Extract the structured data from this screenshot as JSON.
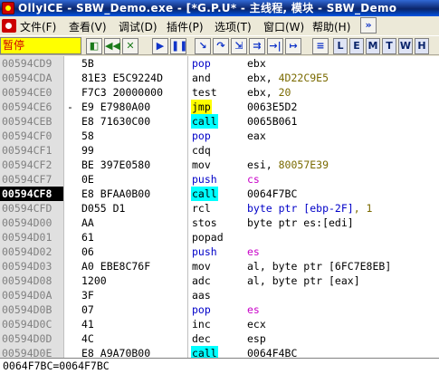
{
  "window": {
    "title": "OllyICE - SBW_Demo.exe - [*G.P.U* -  主线程, 模块 - SBW_Demo"
  },
  "menu": [
    {
      "label": "文件(F)"
    },
    {
      "label": "查看(V)"
    },
    {
      "label": "调试(D)"
    },
    {
      "label": "插件(P)"
    },
    {
      "label": "选项(T)"
    },
    {
      "label": "窗口(W)"
    },
    {
      "label": "帮助(H)"
    }
  ],
  "toolbar": {
    "status": "暂停",
    "letters": [
      "L",
      "E",
      "M",
      "T",
      "W",
      "H"
    ]
  },
  "colors": {
    "selection_bg": "#000000",
    "jump_highlight": "#ffff00",
    "call_highlight": "#00ffff",
    "constant_color": "#7a6a00",
    "keyword_color": "#0000c8",
    "segment_color": "#c800c8",
    "status_bg": "#ffff00",
    "status_fg": "#d00000"
  },
  "disasm": [
    {
      "addr": "00594CD9",
      "mark": "",
      "hex": "5B",
      "mnemonic": "pop",
      "mn_style": "blue",
      "op1": "ebx",
      "op1_style": "",
      "op2": "",
      "op2_style": "",
      "sel": false
    },
    {
      "addr": "00594CDA",
      "mark": "",
      "hex": "81E3 E5C9224D",
      "mnemonic": "and",
      "mn_style": "",
      "op1": "ebx, ",
      "op1_style": "",
      "op2": "4D22C9E5",
      "op2_style": "o",
      "sel": false
    },
    {
      "addr": "00594CE0",
      "mark": "",
      "hex": "F7C3 20000000",
      "mnemonic": "test",
      "mn_style": "",
      "op1": "ebx, ",
      "op1_style": "",
      "op2": "20",
      "op2_style": "o",
      "sel": false
    },
    {
      "addr": "00594CE6",
      "mark": "-",
      "hex": "E9 E7980A00",
      "mnemonic": "jmp",
      "mn_style": "yellow",
      "op1": "0063E5D2",
      "op1_style": "",
      "op2": "",
      "op2_style": "",
      "sel": false
    },
    {
      "addr": "00594CEB",
      "mark": "",
      "hex": "E8 71630C00",
      "mnemonic": "call",
      "mn_style": "cyan",
      "op1": "0065B061",
      "op1_style": "",
      "op2": "",
      "op2_style": "",
      "sel": false
    },
    {
      "addr": "00594CF0",
      "mark": "",
      "hex": "58",
      "mnemonic": "pop",
      "mn_style": "blue",
      "op1": "eax",
      "op1_style": "",
      "op2": "",
      "op2_style": "",
      "sel": false
    },
    {
      "addr": "00594CF1",
      "mark": "",
      "hex": "99",
      "mnemonic": "cdq",
      "mn_style": "",
      "op1": "",
      "op1_style": "",
      "op2": "",
      "op2_style": "",
      "sel": false
    },
    {
      "addr": "00594CF2",
      "mark": "",
      "hex": "BE 397E0580",
      "mnemonic": "mov",
      "mn_style": "",
      "op1": "esi, ",
      "op1_style": "",
      "op2": "80057E39",
      "op2_style": "o",
      "sel": false
    },
    {
      "addr": "00594CF7",
      "mark": "",
      "hex": "0E",
      "mnemonic": "push",
      "mn_style": "blue",
      "op1": "cs",
      "op1_style": "m",
      "op2": "",
      "op2_style": "",
      "sel": false
    },
    {
      "addr": "00594CF8",
      "mark": "",
      "hex": "E8 BFAA0B00",
      "mnemonic": "call",
      "mn_style": "cyan",
      "op1": "0064F7BC",
      "op1_style": "",
      "op2": "",
      "op2_style": "",
      "sel": true
    },
    {
      "addr": "00594CFD",
      "mark": "",
      "hex": "D055 D1",
      "mnemonic": "rcl",
      "mn_style": "",
      "op1": "byte ptr [ebp-2F]",
      "op1_style": "b",
      "op2": ", 1",
      "op2_style": "o",
      "sel": false
    },
    {
      "addr": "00594D00",
      "mark": "",
      "hex": "AA",
      "mnemonic": "stos",
      "mn_style": "",
      "op1": "byte ptr es:[edi]",
      "op1_style": "",
      "op2": "",
      "op2_style": "",
      "sel": false
    },
    {
      "addr": "00594D01",
      "mark": "",
      "hex": "61",
      "mnemonic": "popad",
      "mn_style": "",
      "op1": "",
      "op1_style": "",
      "op2": "",
      "op2_style": "",
      "sel": false
    },
    {
      "addr": "00594D02",
      "mark": "",
      "hex": "06",
      "mnemonic": "push",
      "mn_style": "blue",
      "op1": "es",
      "op1_style": "m",
      "op2": "",
      "op2_style": "",
      "sel": false
    },
    {
      "addr": "00594D03",
      "mark": "",
      "hex": "A0 EBE8C76F",
      "mnemonic": "mov",
      "mn_style": "",
      "op1": "al, byte ptr [6FC7E8EB]",
      "op1_style": "",
      "op2": "",
      "op2_style": "",
      "sel": false
    },
    {
      "addr": "00594D08",
      "mark": "",
      "hex": "1200",
      "mnemonic": "adc",
      "mn_style": "",
      "op1": "al, byte ptr [eax]",
      "op1_style": "",
      "op2": "",
      "op2_style": "",
      "sel": false
    },
    {
      "addr": "00594D0A",
      "mark": "",
      "hex": "3F",
      "mnemonic": "aas",
      "mn_style": "",
      "op1": "",
      "op1_style": "",
      "op2": "",
      "op2_style": "",
      "sel": false
    },
    {
      "addr": "00594D0B",
      "mark": "",
      "hex": "07",
      "mnemonic": "pop",
      "mn_style": "blue",
      "op1": "es",
      "op1_style": "m",
      "op2": "",
      "op2_style": "",
      "sel": false
    },
    {
      "addr": "00594D0C",
      "mark": "",
      "hex": "41",
      "mnemonic": "inc",
      "mn_style": "",
      "op1": "ecx",
      "op1_style": "",
      "op2": "",
      "op2_style": "",
      "sel": false
    },
    {
      "addr": "00594D0D",
      "mark": "",
      "hex": "4C",
      "mnemonic": "dec",
      "mn_style": "",
      "op1": "esp",
      "op1_style": "",
      "op2": "",
      "op2_style": "",
      "sel": false
    },
    {
      "addr": "00594D0E",
      "mark": "",
      "hex": "E8 A9A70B00",
      "mnemonic": "call",
      "mn_style": "cyan",
      "op1": "0064F4BC",
      "op1_style": "",
      "op2": "",
      "op2_style": "",
      "sel": false
    }
  ],
  "info": {
    "text": "0064F7BC=0064F7BC"
  }
}
